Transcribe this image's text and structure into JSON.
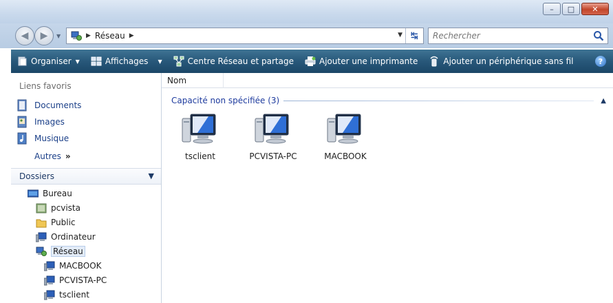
{
  "window": {
    "controls": {
      "minimize": "–",
      "maximize": "□",
      "close": "✕"
    }
  },
  "address_bar": {
    "path": "Réseau",
    "search_placeholder": "Rechercher"
  },
  "toolbar": {
    "items": [
      {
        "label": "Organiser",
        "icon": "organize-icon",
        "has_dropdown": true
      },
      {
        "label": "Affichages",
        "icon": "views-icon",
        "has_dropdown": true
      },
      {
        "label": "Centre Réseau et partage",
        "icon": "network-center-icon",
        "has_dropdown": false
      },
      {
        "label": "Ajouter une imprimante",
        "icon": "printer-icon",
        "has_dropdown": false
      },
      {
        "label": "Ajouter un périphérique sans fil",
        "icon": "wireless-device-icon",
        "has_dropdown": false
      }
    ],
    "help": "?"
  },
  "favorites": {
    "header": "Liens favoris",
    "items": [
      {
        "label": "Documents",
        "icon": "documents-icon"
      },
      {
        "label": "Images",
        "icon": "images-icon"
      },
      {
        "label": "Musique",
        "icon": "music-icon"
      }
    ],
    "more": "Autres",
    "more_glyph": "»"
  },
  "folders": {
    "header": "Dossiers",
    "tree": [
      {
        "label": "Bureau",
        "icon": "desktop-icon",
        "level": 0,
        "selected": false
      },
      {
        "label": "pcvista",
        "icon": "user-folder-icon",
        "level": 1,
        "selected": false
      },
      {
        "label": "Public",
        "icon": "folder-icon",
        "level": 1,
        "selected": false
      },
      {
        "label": "Ordinateur",
        "icon": "computer-icon",
        "level": 1,
        "selected": false
      },
      {
        "label": "Réseau",
        "icon": "network-icon",
        "level": 1,
        "selected": true
      },
      {
        "label": "MACBOOK",
        "icon": "computer-icon",
        "level": 2,
        "selected": false
      },
      {
        "label": "PCVISTA-PC",
        "icon": "computer-icon",
        "level": 2,
        "selected": false
      },
      {
        "label": "tsclient",
        "icon": "computer-icon",
        "level": 2,
        "selected": false
      }
    ]
  },
  "main": {
    "column_header": "Nom",
    "group_label": "Capacité non spécifiée (3)",
    "items": [
      {
        "label": "tsclient",
        "icon": "network-computer-icon"
      },
      {
        "label": "PCVISTA-PC",
        "icon": "network-computer-icon"
      },
      {
        "label": "MACBOOK",
        "icon": "network-computer-icon"
      }
    ]
  },
  "colors": {
    "toolbar_top": "#3f7494",
    "toolbar_bottom": "#1b4767",
    "link_blue": "#1a3f88",
    "group_blue": "#1e3b9e",
    "selection": "#e3ecf8"
  }
}
